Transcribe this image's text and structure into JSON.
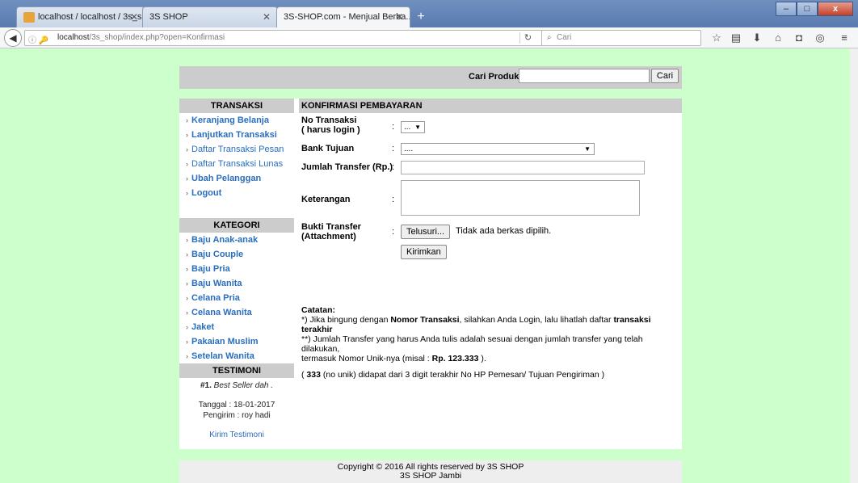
{
  "browser": {
    "tabs": [
      {
        "label": "localhost / localhost / 3s_s..."
      },
      {
        "label": "3S SHOP"
      },
      {
        "label": "3S-SHOP.com - Menjual Berba..."
      }
    ],
    "url": {
      "host": "localhost",
      "path": "/3s_shop/index.php?open=Konfirmasi"
    },
    "search_placeholder": "Cari",
    "win_close": "x"
  },
  "header": {
    "search_label": "Cari Produk",
    "search_button": "Cari"
  },
  "sidebar": {
    "transaksi_title": "TRANSAKSI",
    "transaksi_items": [
      "Keranjang Belanja",
      "Lanjutkan Transaksi",
      "Daftar Transaksi Pesan",
      "Daftar Transaksi Lunas",
      "Ubah Pelanggan",
      "Logout"
    ],
    "kategori_title": "KATEGORI",
    "kategori_items": [
      "Baju Anak-anak",
      "Baju Couple",
      "Baju Pria",
      "Baju Wanita",
      "Celana Pria",
      "Celana Wanita",
      "Jaket",
      "Pakaian Muslim",
      "Setelan Wanita"
    ],
    "testimoni_title": "TESTIMONI",
    "testimoni": {
      "number": "#1.",
      "text": "Best Seller dah .",
      "date": "Tanggal : 18-01-2017",
      "sender": "Pengirim : roy hadi",
      "link": "Kirim Testimoni"
    }
  },
  "form": {
    "title": "KONFIRMASI PEMBAYARAN",
    "no_transaksi_label": "No Transaksi",
    "no_transaksi_sub": "( harus login )",
    "no_transaksi_value": "...",
    "bank_label": "Bank Tujuan",
    "bank_value": "....",
    "jumlah_label": "Jumlah Transfer (Rp.)",
    "keterangan_label": "Keterangan",
    "bukti_label": "Bukti Transfer",
    "bukti_sub": "(Attachment)",
    "file_button": "Telusuri...",
    "file_status": "Tidak ada berkas dipilih.",
    "submit": "Kirimkan",
    "colon": ":"
  },
  "notes": {
    "title": "Catatan:",
    "line1_a": "*) Jika bingung dengan ",
    "line1_b": "Nomor Transaksi",
    "line1_c": ", silahkan Anda Login, lalu lihatlah daftar ",
    "line1_d": "transaksi terakhir",
    "line2": "**) Jumlah Transfer yang harus Anda tulis adalah sesuai dengan jumlah transfer yang telah dilakukan,",
    "line3_a": "termasuk Nomor Unik-nya (misal : ",
    "line3_b": "Rp. 123.333",
    "line3_c": " ).",
    "line4_a": "( ",
    "line4_b": "333",
    "line4_c": " (no unik) didapat dari 3 digit terakhir No HP Pemesan/ Tujuan Pengiriman )"
  },
  "footer": {
    "line1": "Copyright © 2016 All rights reserved by 3S SHOP",
    "line2": "3S SHOP Jambi"
  }
}
